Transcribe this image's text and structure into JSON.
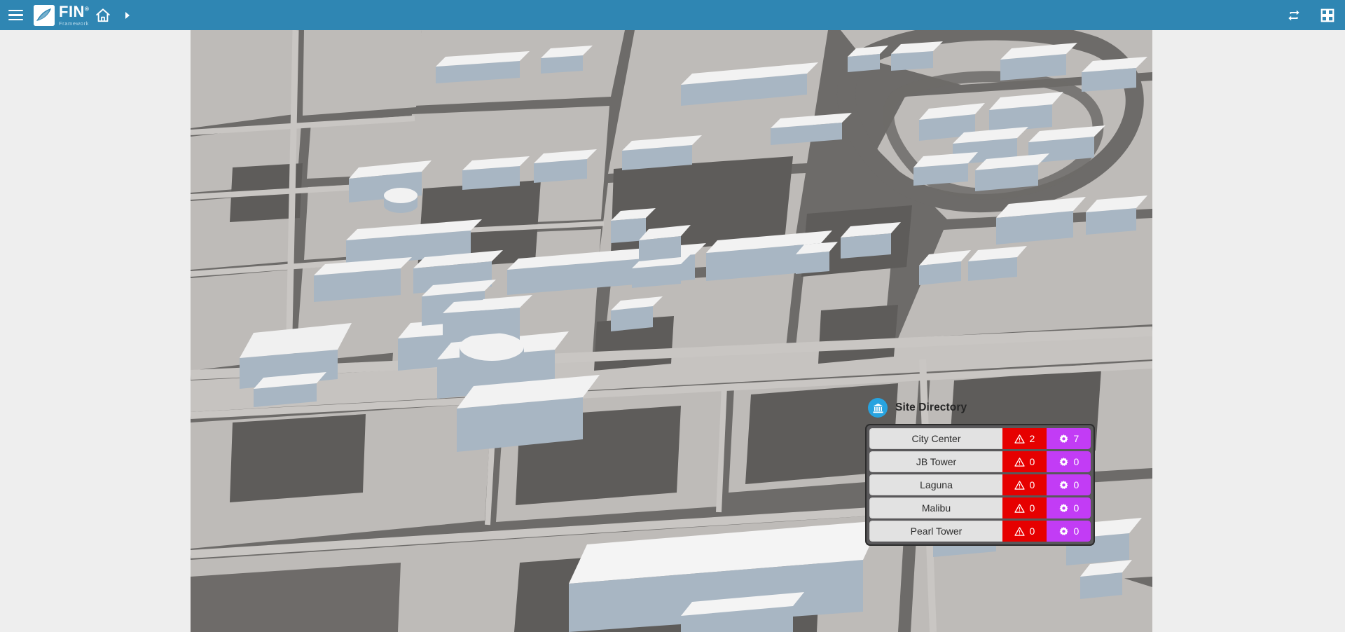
{
  "app": {
    "brand_name": "FIN",
    "brand_trademark": "®",
    "brand_subtitle": "Framework",
    "header_color": "#2f86b3"
  },
  "topbar": {
    "menu_label": "Menu",
    "home_label": "Home",
    "breadcrumb_next_label": "Next",
    "sync_label": "Sync",
    "apps_label": "Apps"
  },
  "site_directory": {
    "title": "Site Directory",
    "badge_icon": "bank-icon",
    "alarm_icon": "warning-triangle-icon",
    "point_icon": "gear-icon",
    "alarm_color": "#e60000",
    "point_color": "#c23cf5",
    "sites": [
      {
        "name": "City Center",
        "alarms": "2",
        "points": "7"
      },
      {
        "name": "JB Tower",
        "alarms": "0",
        "points": "0"
      },
      {
        "name": "Laguna",
        "alarms": "0",
        "points": "0"
      },
      {
        "name": "Malibu",
        "alarms": "0",
        "points": "0"
      },
      {
        "name": "Pearl Tower",
        "alarms": "0",
        "points": "0"
      }
    ]
  },
  "map": {
    "description": "3D isometric city block map",
    "ground_color": "#bdbab7",
    "road_color": "#6a6867",
    "building_top_color": "#f0f0f0",
    "building_side_color": "#a9b7c4"
  }
}
